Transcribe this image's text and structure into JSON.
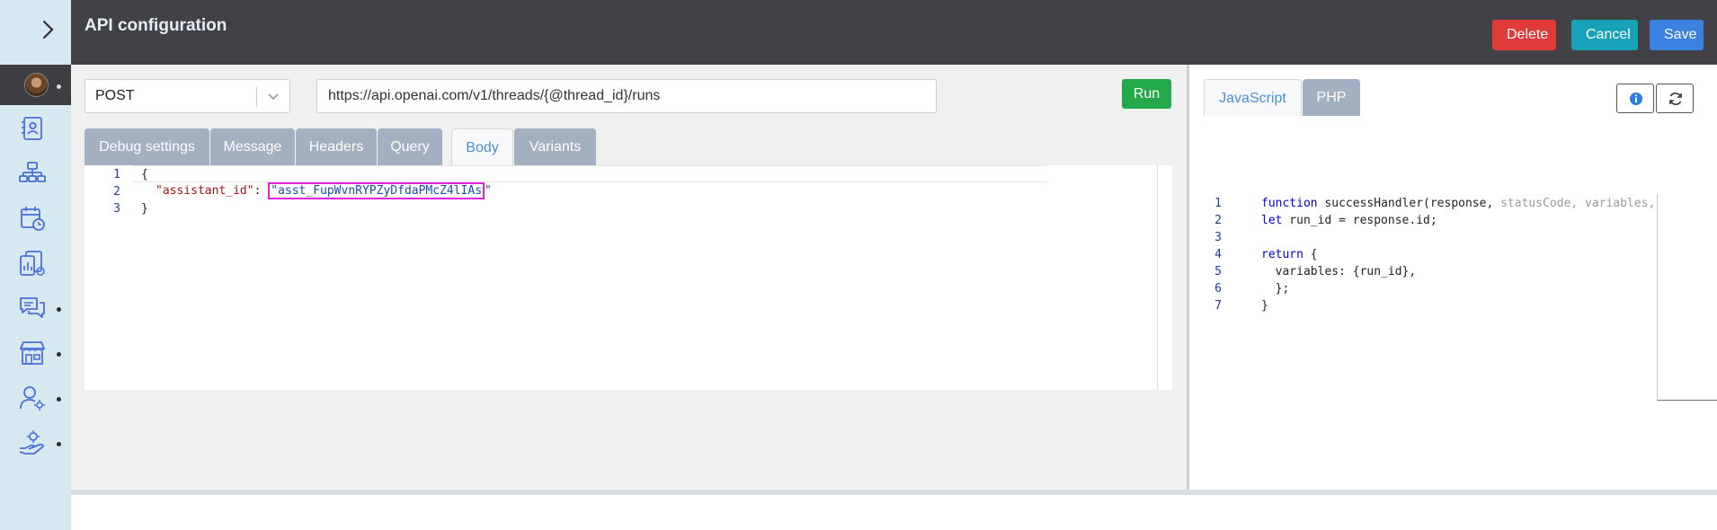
{
  "header": {
    "title": "API configuration",
    "delete_label": "Delete",
    "cancel_label": "Cancel",
    "save_label": "Save"
  },
  "sidebar": {
    "items": [
      {
        "icon": "contacts-book-icon"
      },
      {
        "icon": "org-chart-icon"
      },
      {
        "icon": "calendar-clock-icon"
      },
      {
        "icon": "reports-icon"
      },
      {
        "icon": "chat-icon"
      },
      {
        "icon": "store-icon"
      },
      {
        "icon": "user-settings-icon"
      },
      {
        "icon": "hand-gear-icon"
      }
    ]
  },
  "request": {
    "method": "POST",
    "url": "https://api.openai.com/v1/threads/{@thread_id}/runs",
    "run_label": "Run"
  },
  "tabs": [
    {
      "label": "Debug settings"
    },
    {
      "label": "Message"
    },
    {
      "label": "Headers"
    },
    {
      "label": "Query"
    },
    {
      "label": "Body",
      "active": true
    },
    {
      "label": "Variants"
    }
  ],
  "body_editor": {
    "line_numbers": [
      "1",
      "2",
      "3"
    ],
    "line1": "{",
    "key": "\"assistant_id\"",
    "colon": ": ",
    "value_open_quote": "\"",
    "value": "asst_FupWvnRYPZyDfdaPMcZ4lIAs",
    "value_close_quote": "\"",
    "line3": "}"
  },
  "handler": {
    "tabs": [
      {
        "label": "JavaScript",
        "active": true
      },
      {
        "label": "PHP"
      }
    ],
    "line_numbers": [
      "1",
      "2",
      "3",
      "4",
      "5",
      "6",
      "7"
    ],
    "l1_kw": "function",
    "l1_rest": " successHandler(response, ",
    "l1_faded": "statusCode, variables,",
    "l2_kw": "let",
    "l2_rest": " run_id = response.id;",
    "l4_kw": "return",
    "l4_rest": " {",
    "l5": "  variables: {run_id},",
    "l6": "  };",
    "l7": "}"
  },
  "colors": {
    "delete": "#e03a3a",
    "cancel": "#17a2b8",
    "save": "#3b82e0",
    "run": "#23a94a",
    "highlight": "#e024d8"
  }
}
